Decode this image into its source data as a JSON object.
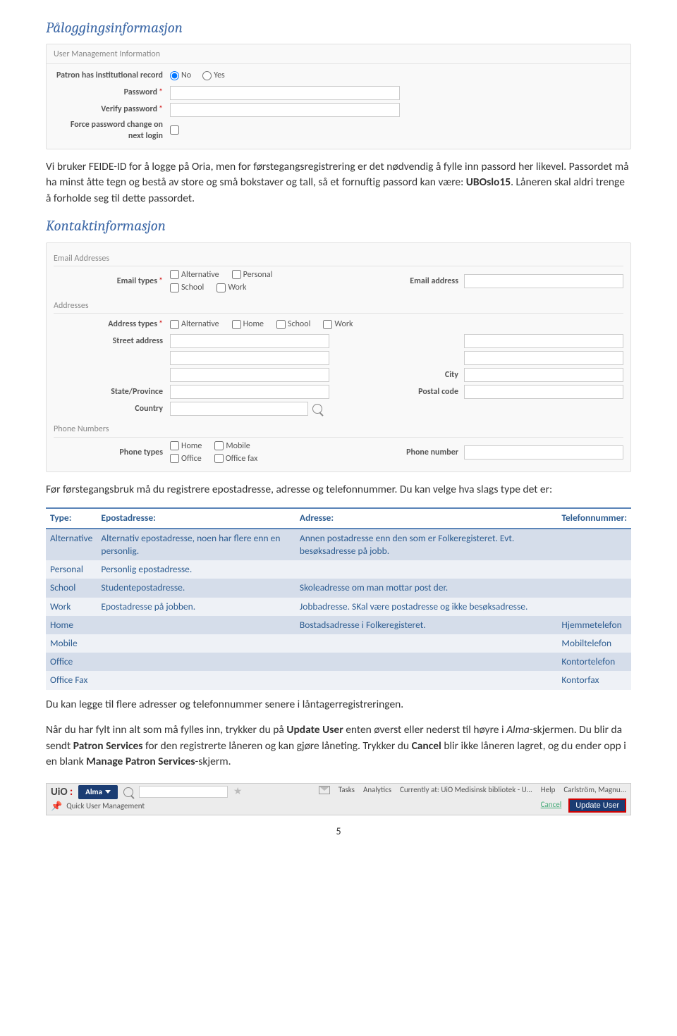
{
  "section1_title": "Påloggingsinformasjon",
  "panel1_head": "User Management Information",
  "p1_patron": "Patron has institutional record",
  "p1_no": "No",
  "p1_yes": "Yes",
  "p1_password": "Password",
  "p1_verify": "Verify password",
  "p1_force": "Force password change on next login",
  "para1": "Vi bruker FEIDE-ID for å logge på Oria, men for førstegangsregistrering er det nødvendig å fylle inn passord her likevel. Passordet må ha minst åtte tegn og bestå av store og små bokstaver og tall, så et fornuftig passord kan være: ",
  "para1_bold": "UBOslo15",
  "para1_tail": ". Låneren skal aldri trenge å forholde seg til dette passordet.",
  "section2_title": "Kontaktinformasjon",
  "p2_email_addresses": "Email Addresses",
  "p2_email_types": "Email types",
  "p2_email_address": "Email address",
  "cb_alternative": "Alternative",
  "cb_personal": "Personal",
  "cb_school": "School",
  "cb_work": "Work",
  "cb_home": "Home",
  "cb_mobile": "Mobile",
  "cb_office": "Office",
  "cb_officefax": "Office fax",
  "p2_addresses": "Addresses",
  "p2_address_types": "Address types",
  "p2_street": "Street address",
  "p2_city": "City",
  "p2_state": "State/Province",
  "p2_postal": "Postal code",
  "p2_country": "Country",
  "p2_phone_numbers": "Phone Numbers",
  "p2_phone_types": "Phone types",
  "p2_phone_number": "Phone number",
  "para2": "Før førstegangsbruk må du registrere epostadresse, adresse og telefonnummer. Du kan velge hva slags type det er:",
  "thead": {
    "type": "Type:",
    "epost": "Epostadresse:",
    "adresse": "Adresse:",
    "tlf": "Telefonnummer:"
  },
  "rows": [
    {
      "type": "Alternative",
      "epost": "Alternativ epostadresse, noen har flere enn en personlig.",
      "adresse": "Annen postadresse enn den som er Folkeregisteret. Evt. besøksadresse på jobb.",
      "tlf": ""
    },
    {
      "type": "Personal",
      "epost": "Personlig epostadresse.",
      "adresse": "",
      "tlf": ""
    },
    {
      "type": "School",
      "epost": "Studentepostadresse.",
      "adresse": "Skoleadresse om man mottar post der.",
      "tlf": ""
    },
    {
      "type": "Work",
      "epost": "Epostadresse på jobben.",
      "adresse": "Jobbadresse. SKal være postadresse og ikke besøksadresse.",
      "tlf": ""
    },
    {
      "type": "Home",
      "epost": "",
      "adresse": "Bostadsadresse i Folkeregisteret.",
      "tlf": "Hjemmetelefon"
    },
    {
      "type": "Mobile",
      "epost": "",
      "adresse": "",
      "tlf": "Mobiltelefon"
    },
    {
      "type": "Office",
      "epost": "",
      "adresse": "",
      "tlf": "Kontortelefon"
    },
    {
      "type": "Office Fax",
      "epost": "",
      "adresse": "",
      "tlf": "Kontorfax"
    }
  ],
  "para3": "Du kan legge til flere adresser og telefonnummer senere i låntagerregistreringen.",
  "para4a": "Når du har fylt inn alt som må fylles inn, trykker du på ",
  "para4b": "Update User",
  "para4c": " enten øverst eller nederst til høyre i ",
  "para4d": "Alma",
  "para4e": "-skjermen. Du blir da sendt ",
  "para4f": "Patron Services",
  "para4g": " for den registrerte låneren og kan gjøre låneting. Trykker du ",
  "para4h": "Cancel",
  "para4i": " blir ikke låneren lagret, og du ender opp i en blank ",
  "para4j": "Manage Patron Services",
  "para4k": "-skjerm.",
  "footer": {
    "uio": "UiO",
    "alma": "Alma",
    "tasks": "Tasks",
    "analytics": "Analytics",
    "loc_pre": "Currently at:",
    "loc": "UiO Medisinsk bibliotek - U...",
    "help": "Help",
    "user": "Carlström, Magnu...",
    "quick": "Quick User Management",
    "cancel": "Cancel",
    "update": "Update User"
  },
  "pagenum": "5"
}
